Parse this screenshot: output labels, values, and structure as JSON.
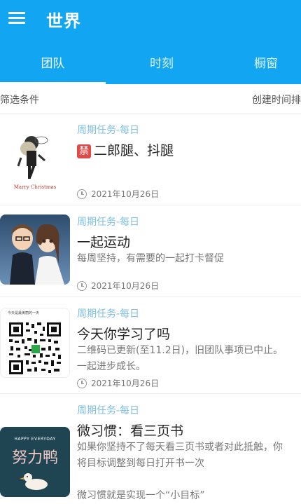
{
  "header": {
    "title": "世界"
  },
  "tabs": [
    {
      "label": "团队",
      "active": true
    },
    {
      "label": "时刻",
      "active": false
    },
    {
      "label": "橱窗",
      "active": false
    }
  ],
  "filter": {
    "left": "筛选条件",
    "right": "创建时间排"
  },
  "items": [
    {
      "tag": "周期任务-每日",
      "badge": "禁",
      "title": "二郎腿、抖腿",
      "desc": [],
      "date": "2021年10月26日",
      "thumb_text": "Marry Christmas"
    },
    {
      "tag": "周期任务-每日",
      "title": "一起运动",
      "desc": [
        "每周坚持，有需要的一起打卡督促"
      ],
      "date": "2021年10月26日"
    },
    {
      "tag": "周期任务-每日",
      "title": "今天你学习了吗",
      "desc": [
        "二维码已更新(至11.2日)，旧团队事项已中止。",
        "一起进步成长。"
      ],
      "date": "2021年10月26日",
      "thumb_text": "今天是最美丽的一天"
    },
    {
      "tag": "周期任务-每日",
      "title": "微习惯：看三页书",
      "desc": [
        "如果你坚持不了每天看三页书或者对此抵触，你",
        "将目标调整到每日打开书一次",
        "",
        "微习惯就是实现一个“小目标”"
      ],
      "thumb_text_top": "HAPPY EVERYDAY",
      "thumb_text_main": "努力鸭"
    }
  ],
  "colors": {
    "primary": "#11a5f2",
    "tag": "#7ec0e6",
    "badge": "#e14a4a"
  }
}
